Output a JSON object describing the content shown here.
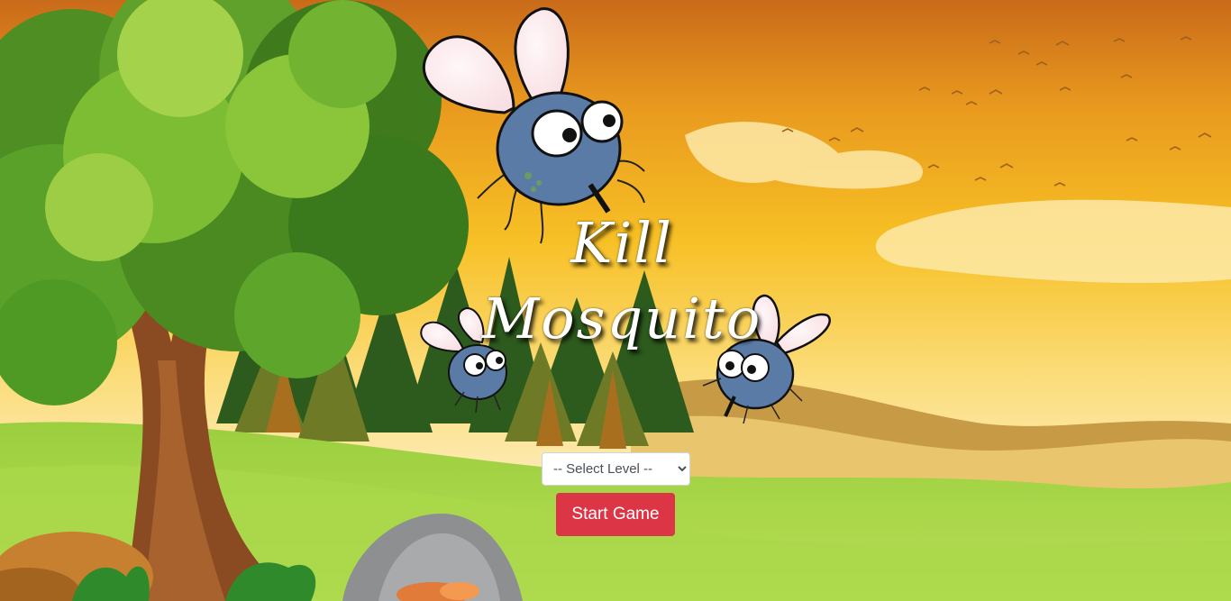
{
  "game": {
    "title_line1": "Kill",
    "title_line2": "Mosquito",
    "level_select": {
      "selected": "-- Select Level --",
      "options": [
        "-- Select Level --"
      ]
    },
    "start_button_label": "Start Game"
  },
  "colors": {
    "start_button": "#dc3545",
    "sky_top": "#d4731c",
    "sky_mid": "#f4b51c",
    "sky_low": "#fbe7a4",
    "grass": "#8dc63f",
    "mosquito_body": "#5a7aa6"
  }
}
